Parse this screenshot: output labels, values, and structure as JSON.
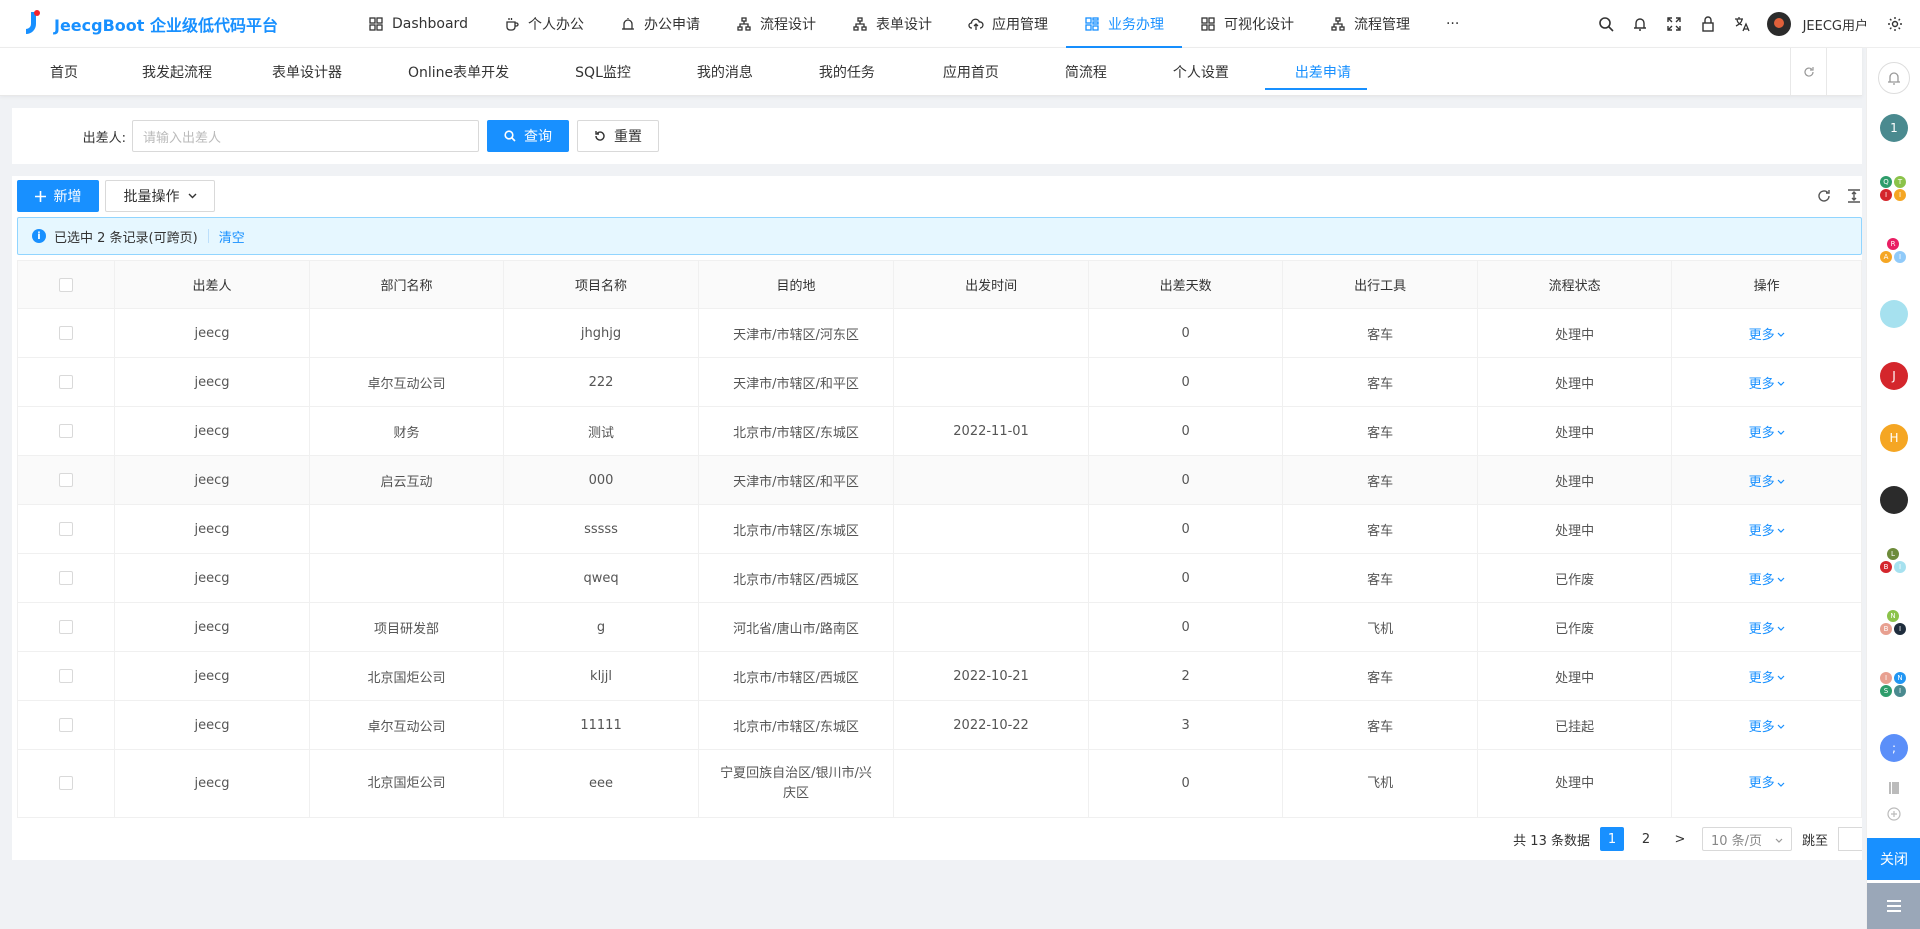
{
  "app": {
    "title": "JeecgBoot 企业级低代码平台"
  },
  "topnav": [
    {
      "label": "Dashboard",
      "icon": "dashboard-icon"
    },
    {
      "label": "个人办公",
      "icon": "coffee-icon"
    },
    {
      "label": "办公申请",
      "icon": "alarm-icon"
    },
    {
      "label": "流程设计",
      "icon": "flow-icon"
    },
    {
      "label": "表单设计",
      "icon": "flow-icon"
    },
    {
      "label": "应用管理",
      "icon": "cloud-upload-icon"
    },
    {
      "label": "业务办理",
      "icon": "apps-icon"
    },
    {
      "label": "可视化设计",
      "icon": "grid-icon"
    },
    {
      "label": "流程管理",
      "icon": "flow-icon"
    }
  ],
  "topnav_more": "···",
  "user": {
    "name": "JEECG用户"
  },
  "tabs": [
    "首页",
    "我发起流程",
    "表单设计器",
    "Online表单开发",
    "SQL监控",
    "我的消息",
    "我的任务",
    "应用首页",
    "简流程",
    "个人设置",
    "出差申请"
  ],
  "search": {
    "label": "出差人:",
    "placeholder": "请输入出差人",
    "query_label": "查询",
    "reset_label": "重置"
  },
  "toolbar": {
    "add_label": "新增",
    "batch_label": "批量操作"
  },
  "alert": {
    "text": "已选中 2 条记录(可跨页)",
    "clear_label": "清空"
  },
  "table": {
    "columns": [
      "出差人",
      "部门名称",
      "项目名称",
      "目的地",
      "出发时间",
      "出差天数",
      "出行工具",
      "流程状态",
      "操作"
    ],
    "action_label": "更多",
    "rows": [
      {
        "person": "jeecg",
        "dept": "",
        "project": "jhghjg",
        "dest": "天津市/市辖区/河东区",
        "date": "",
        "days": "0",
        "tool": "客车",
        "status": "处理中"
      },
      {
        "person": "jeecg",
        "dept": "卓尔互动公司",
        "project": "222",
        "dest": "天津市/市辖区/和平区",
        "date": "",
        "days": "0",
        "tool": "客车",
        "status": "处理中"
      },
      {
        "person": "jeecg",
        "dept": "财务",
        "project": "测试",
        "dest": "北京市/市辖区/东城区",
        "date": "2022-11-01",
        "days": "0",
        "tool": "客车",
        "status": "处理中"
      },
      {
        "person": "jeecg",
        "dept": "启云互动",
        "project": "000",
        "dest": "天津市/市辖区/和平区",
        "date": "",
        "days": "0",
        "tool": "客车",
        "status": "处理中"
      },
      {
        "person": "jeecg",
        "dept": "",
        "project": "sssss",
        "dest": "北京市/市辖区/东城区",
        "date": "",
        "days": "0",
        "tool": "客车",
        "status": "处理中"
      },
      {
        "person": "jeecg",
        "dept": "",
        "project": "qweq",
        "dest": "北京市/市辖区/西城区",
        "date": "",
        "days": "0",
        "tool": "客车",
        "status": "已作废"
      },
      {
        "person": "jeecg",
        "dept": "项目研发部",
        "project": "g",
        "dest": "河北省/唐山市/路南区",
        "date": "",
        "days": "0",
        "tool": "飞机",
        "status": "已作废"
      },
      {
        "person": "jeecg",
        "dept": "北京国炬公司",
        "project": "kljjl",
        "dest": "北京市/市辖区/西城区",
        "date": "2022-10-21",
        "days": "2",
        "tool": "客车",
        "status": "处理中"
      },
      {
        "person": "jeecg",
        "dept": "卓尔互动公司",
        "project": "11111",
        "dest": "北京市/市辖区/东城区",
        "date": "2022-10-22",
        "days": "3",
        "tool": "客车",
        "status": "已挂起"
      },
      {
        "person": "jeecg",
        "dept": "北京国炬公司",
        "project": "eee",
        "dest": "宁夏回族自治区/银川市/兴庆区",
        "date": "",
        "days": "0",
        "tool": "飞机",
        "status": "处理中"
      }
    ]
  },
  "pagination": {
    "total_text": "共 13 条数据",
    "pages": [
      "1",
      "2"
    ],
    "current": "1",
    "next": ">",
    "page_size": "10 条/页",
    "jump_label": "跳至"
  },
  "rightbar": {
    "avatars": [
      {
        "text": "1",
        "color": "#4a8a8f"
      },
      {
        "text": "J",
        "color": "#d4262c"
      },
      {
        "text": "H",
        "color": "#f5a623"
      },
      {
        "text": ";",
        "color": "#5b8ff9"
      }
    ],
    "close_label": "关闭"
  },
  "colors": {
    "primary": "#1890ff",
    "alert_bg": "#e6f7ff"
  }
}
